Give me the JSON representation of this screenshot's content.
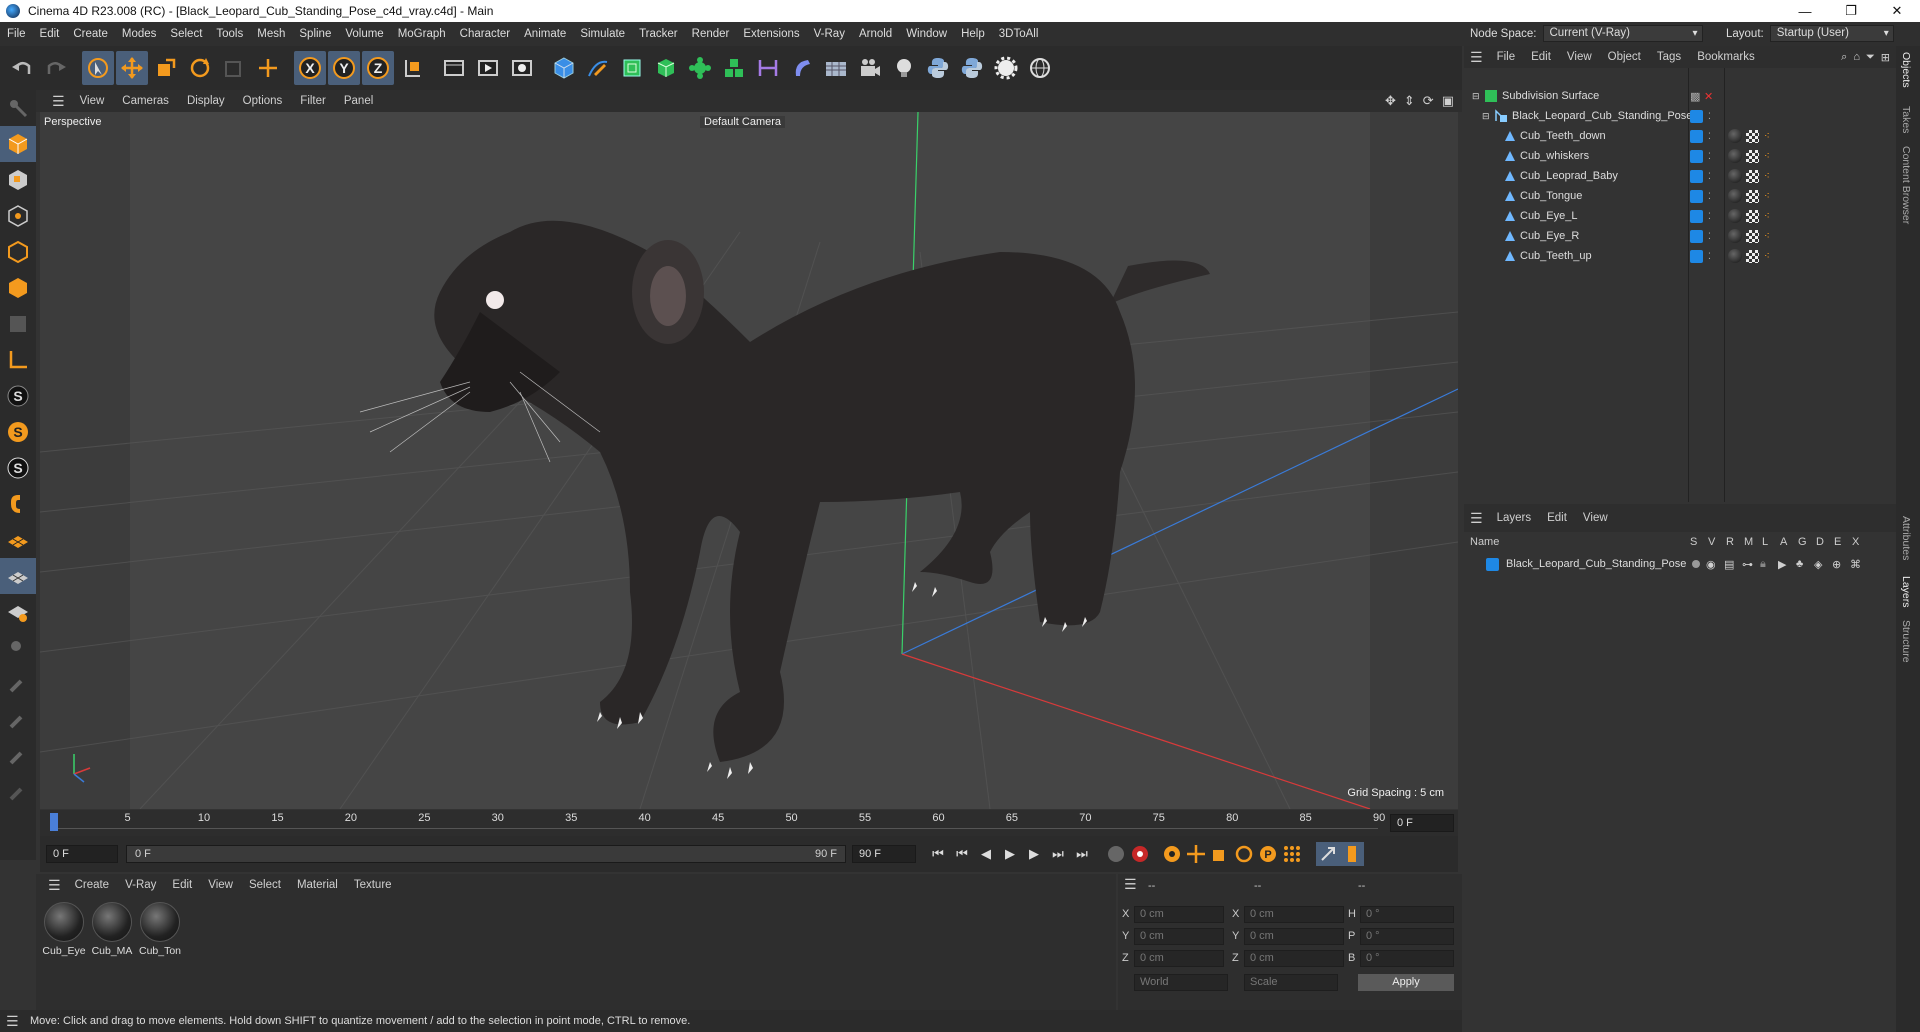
{
  "window": {
    "title": "Cinema 4D R23.008 (RC) - [Black_Leopard_Cub_Standing_Pose_c4d_vray.c4d] - Main",
    "min": "—",
    "max": "❐",
    "close": "✕"
  },
  "menubar": {
    "items": [
      "File",
      "Edit",
      "Create",
      "Modes",
      "Select",
      "Tools",
      "Mesh",
      "Spline",
      "Volume",
      "MoGraph",
      "Character",
      "Animate",
      "Simulate",
      "Tracker",
      "Render",
      "Extensions",
      "V-Ray",
      "Arnold",
      "Window",
      "Help",
      "3DToAll"
    ],
    "node_space_label": "Node Space:",
    "node_space_value": "Current (V-Ray)",
    "layout_label": "Layout:",
    "layout_value": "Startup (User)"
  },
  "toolbar": {
    "icons": [
      "undo-icon",
      "redo-icon",
      "live-select-icon",
      "move-icon",
      "scale-icon",
      "rotate-icon",
      "recent-tool-icon",
      "add-icon",
      "x-axis-icon",
      "y-axis-icon",
      "z-axis-icon",
      "coord-system-icon",
      "render-view-icon",
      "render-icon",
      "render-settings-icon",
      "cube-icon",
      "pen-icon",
      "subdivide-icon",
      "extrude-icon",
      "cloner-icon",
      "array-icon",
      "symmetry-icon",
      "deformer-icon",
      "floor-icon",
      "camera-icon",
      "light-icon",
      "python-icon",
      "python2-icon",
      "gear-icon",
      "globe-icon"
    ]
  },
  "viewport": {
    "menu": [
      "View",
      "Cameras",
      "Display",
      "Options",
      "Filter",
      "Panel"
    ],
    "label": "Perspective",
    "camera": "Default Camera",
    "grid_spacing": "Grid Spacing : 5 cm"
  },
  "timeline": {
    "ticks": [
      "0",
      "5",
      "10",
      "15",
      "20",
      "25",
      "30",
      "35",
      "40",
      "45",
      "50",
      "55",
      "60",
      "65",
      "70",
      "75",
      "80",
      "85",
      "90"
    ],
    "current": "0 F"
  },
  "transport": {
    "start": "0 F",
    "range_start": "0 F",
    "range_end": "90 F",
    "end": "90 F"
  },
  "materials": {
    "menu": [
      "Create",
      "V-Ray",
      "Edit",
      "View",
      "Select",
      "Material",
      "Texture"
    ],
    "items": [
      "Cub_Eye",
      "Cub_MA",
      "Cub_Ton"
    ]
  },
  "coords": {
    "header": [
      "--",
      "--",
      "--"
    ],
    "rows": [
      {
        "l1": "X",
        "v1": "0 cm",
        "l2": "X",
        "v2": "0 cm",
        "l3": "H",
        "v3": "0 °"
      },
      {
        "l1": "Y",
        "v1": "0 cm",
        "l2": "Y",
        "v2": "0 cm",
        "l3": "P",
        "v3": "0 °"
      },
      {
        "l1": "Z",
        "v1": "0 cm",
        "l2": "Z",
        "v2": "0 cm",
        "l3": "B",
        "v3": "0 °"
      }
    ],
    "mode1": "World",
    "mode2": "Scale",
    "apply": "Apply"
  },
  "status": "Move: Click and drag to move elements. Hold down SHIFT to quantize movement / add to the selection in point mode, CTRL to remove.",
  "objects": {
    "menu": [
      "File",
      "Edit",
      "View",
      "Object",
      "Tags",
      "Bookmarks"
    ],
    "tree": [
      {
        "name": "Subdivision Surface",
        "depth": 0
      },
      {
        "name": "Black_Leopard_Cub_Standing_Pose",
        "depth": 1
      },
      {
        "name": "Cub_Teeth_down",
        "depth": 2
      },
      {
        "name": "Cub_whiskers",
        "depth": 2
      },
      {
        "name": "Cub_Leoprad_Baby",
        "depth": 2
      },
      {
        "name": "Cub_Tongue",
        "depth": 2
      },
      {
        "name": "Cub_Eye_L",
        "depth": 2
      },
      {
        "name": "Cub_Eye_R",
        "depth": 2
      },
      {
        "name": "Cub_Teeth_up",
        "depth": 2
      }
    ]
  },
  "layers": {
    "menu": [
      "Layers",
      "Edit",
      "View"
    ],
    "name_col": "Name",
    "cols": [
      "S",
      "V",
      "R",
      "M",
      "L",
      "A",
      "G",
      "D",
      "E",
      "X"
    ],
    "rows": [
      "Black_Leopard_Cub_Standing_Pose"
    ]
  },
  "side_tabs": [
    "Objects",
    "Takes",
    "Content Browser",
    "Attributes",
    "Layers",
    "Structure"
  ],
  "colors": {
    "accent": "#4a5f7a",
    "layer_blue": "#1e88e5",
    "x_axis": "#d83a3a",
    "y_axis": "#3ad16a",
    "z_axis": "#3a7bd8"
  }
}
